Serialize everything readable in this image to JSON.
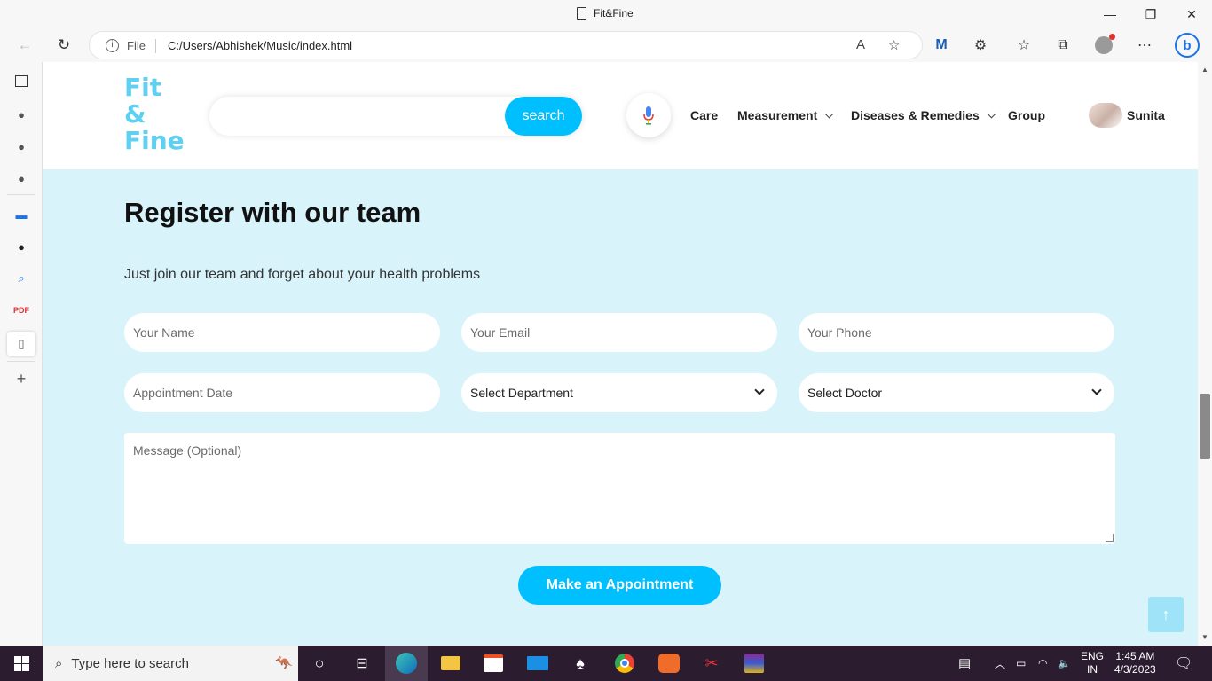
{
  "window": {
    "title": "Fit&Fine",
    "minimize_icon": "minimize-icon",
    "maximize_icon": "restore-icon",
    "close_icon": "close-icon"
  },
  "browser": {
    "scheme_label": "File",
    "url": "C:/Users/Abhishek/Music/index.html"
  },
  "site": {
    "logo_lines": [
      "Fit",
      "&",
      "Fine"
    ],
    "search_button": "search",
    "nav": {
      "care": "Care",
      "measurement": "Measurement",
      "diseases": "Diseases & Remedies",
      "group": "Group"
    },
    "user_name": "Sunita"
  },
  "form": {
    "title": "Register with our team",
    "subtitle": "Just join our team and forget about your health problems",
    "name_placeholder": "Your Name",
    "email_placeholder": "Your Email",
    "phone_placeholder": "Your Phone",
    "date_placeholder": "Appointment Date",
    "department_selected": "Select Department",
    "doctor_selected": "Select Doctor",
    "message_placeholder": "Message (Optional)",
    "submit_label": "Make an Appointment"
  },
  "taskbar": {
    "search_placeholder": "Type here to search",
    "lang_top": "ENG",
    "lang_bottom": "IN",
    "time": "1:45 AM",
    "date": "4/3/2023"
  },
  "colors": {
    "accent": "#00bfff",
    "logo": "#5fd0f2",
    "section_bg": "#d9f3fb",
    "taskbar": "#2b1c2f"
  }
}
